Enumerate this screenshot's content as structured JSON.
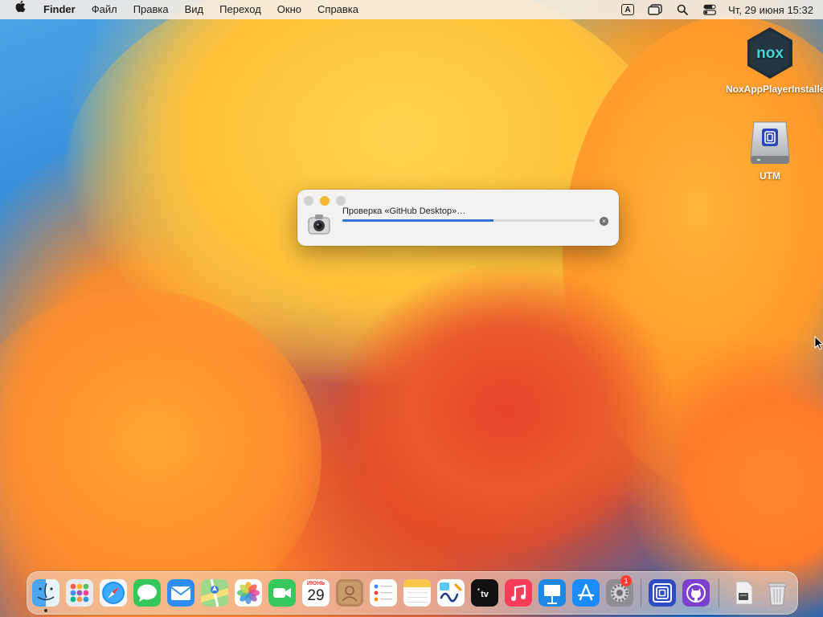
{
  "menubar": {
    "app_name": "Finder",
    "menus": [
      "Файл",
      "Правка",
      "Вид",
      "Переход",
      "Окно",
      "Справка"
    ],
    "input_indicator": "A",
    "clock": "Чт, 29 июня  15:32"
  },
  "desktop_icons": [
    {
      "label": "NoxAppPlayerInstaller",
      "icon": "nox-icon"
    },
    {
      "label": "UTM",
      "icon": "utm-disk-icon"
    }
  ],
  "dialog": {
    "message": "Проверка «GitHub Desktop»…",
    "progress": 0.6
  },
  "dock": {
    "calendar_month": "ИЮНЬ",
    "calendar_day": "29",
    "badge_settings": "1",
    "apps": [
      "finder",
      "launchpad",
      "safari",
      "messages",
      "mail",
      "maps",
      "photos",
      "facetime",
      "calendar",
      "contacts",
      "reminders",
      "notes",
      "freeform",
      "tv",
      "music",
      "keynote",
      "app-store",
      "system-settings",
      "utm",
      "github-desktop",
      "downloads-stack",
      "trash"
    ]
  },
  "colors": {
    "accent": "#2b75d6",
    "badge": "#ff3b30",
    "traffic_close": "#d0d0d0",
    "traffic_minimize": "#f5b731",
    "traffic_zoom": "#d0d0d0"
  }
}
